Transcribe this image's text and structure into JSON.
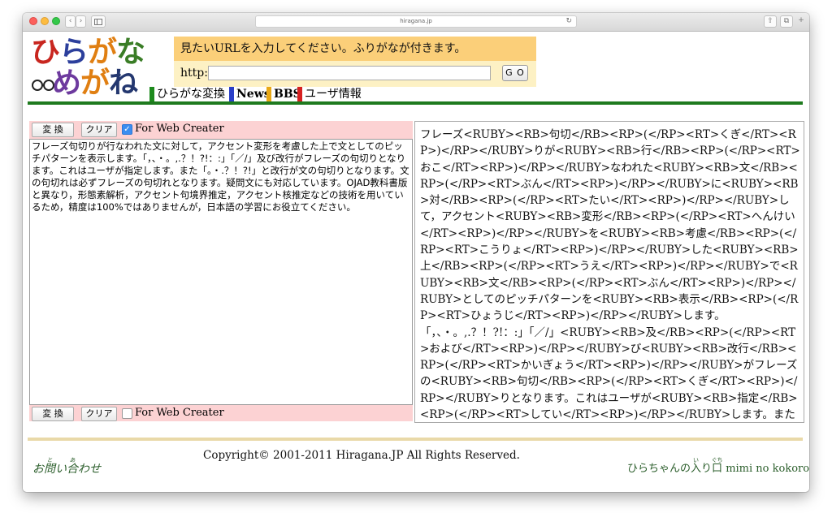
{
  "browser": {
    "address": "hiragana.jp"
  },
  "logo": {
    "line1": [
      "ひ",
      "ら",
      "が",
      "な"
    ],
    "line2": [
      "め",
      "が",
      "ね"
    ]
  },
  "header": {
    "banner": "見たいURLを入力してください。ふりがなが付きます。",
    "url_label": "http://",
    "url_value": "",
    "go_label": "G O"
  },
  "nav": {
    "tabs": [
      {
        "label": "ひらがな変換",
        "bar_color": "#1d8a1d",
        "bold": false
      },
      {
        "label": "News",
        "bar_color": "#2a3fc8",
        "bold": true
      },
      {
        "label": "BBS",
        "bar_color": "#e8a817",
        "bold": true
      },
      {
        "label": "ユーザ情報",
        "bar_color": "#d62020",
        "bold": false
      }
    ]
  },
  "left_panel": {
    "convert_label": "変 換",
    "clear_label": "クリア",
    "web_creator_label": "For Web Creater",
    "top_checkbox_checked": true,
    "bottom_checkbox_checked": false,
    "input_text": "フレーズ句切りが行なわれた文に対して，アクセント変形を考慮した上で文としてのピッチパターンを表示します。「，、・。,.？！?!：:」「／/」及び改行がフレーズの句切りとなります。これはユーザが指定します。また「。・.？！?!」と改行が文の句切りとなります。文の句切れは必ずフレーズの句切れとなります。疑問文にも対応しています。OJAD教科書版と異なり，形態素解析，アクセント句境界推定，アクセント核推定などの技術を用いているため，精度は100%ではありませんが，日本語の学習にお役立てください。"
  },
  "right_panel": {
    "output_text": "フレーズ<RUBY><RB>句切</RB><RP>(</RP><RT>くぎ</RT><RP>)</RP></RUBY>りが<RUBY><RB>行</RB><RP>(</RP><RT>おこ</RT><RP>)</RP></RUBY>なわれた<RUBY><RB>文</RB><RP>(</RP><RT>ぶん</RT><RP>)</RP></RUBY>に<RUBY><RB>対</RB><RP>(</RP><RT>たい</RT><RP>)</RP></RUBY>して，アクセント<RUBY><RB>変形</RB><RP>(</RP><RT>へんけい</RT><RP>)</RP></RUBY>を<RUBY><RB>考慮</RB><RP>(</RP><RT>こうりょ</RT><RP>)</RP></RUBY>した<RUBY><RB>上</RB><RP>(</RP><RT>うえ</RT><RP>)</RP></RUBY>で<RUBY><RB>文</RB><RP>(</RP><RT>ぶん</RT><RP>)</RP></RUBY>としてのピッチパターンを<RUBY><RB>表示</RB><RP>(</RP><RT>ひょうじ</RT><RP>)</RP></RUBY>します。「，、・。,.？！?!：:」「／/」<RUBY><RB>及</RB><RP>(</RP><RT>および</RT><RP>)</RP></RUBY>び<RUBY><RB>改行</RB><RP>(</RP><RT>かいぎょう</RT><RP>)</RP></RUBY>がフレーズの<RUBY><RB>句切</RB><RP>(</RP><RT>くぎ</RT><RP>)</RP></RUBY>りとなります。これはユーザが<RUBY><RB>指定</RB><RP>(</RP><RT>してい</RT><RP>)</RP></RUBY>します。また「。・.？！?!」と<RUBY><RB>改行</RB><RP>(</RP><RT>かいぎょう</RT><RP>)</RP></RUBY>が"
  },
  "footer": {
    "contact_prefix": "お",
    "contact_k1": "問",
    "contact_r1": "と",
    "contact_mid": "い",
    "contact_k2": "合",
    "contact_r2": "あ",
    "contact_suffix": "わせ",
    "copyright": "Copyright© 2001-2011 Hiragana.JP All Rights Reserved.",
    "right_prefix": "ひらちゃんの",
    "right_k1": "入",
    "right_r1": "い",
    "right_mid": "り",
    "right_k2": "口",
    "right_r2": "ぐち",
    "right_suffix": " mimi no kokoro"
  }
}
